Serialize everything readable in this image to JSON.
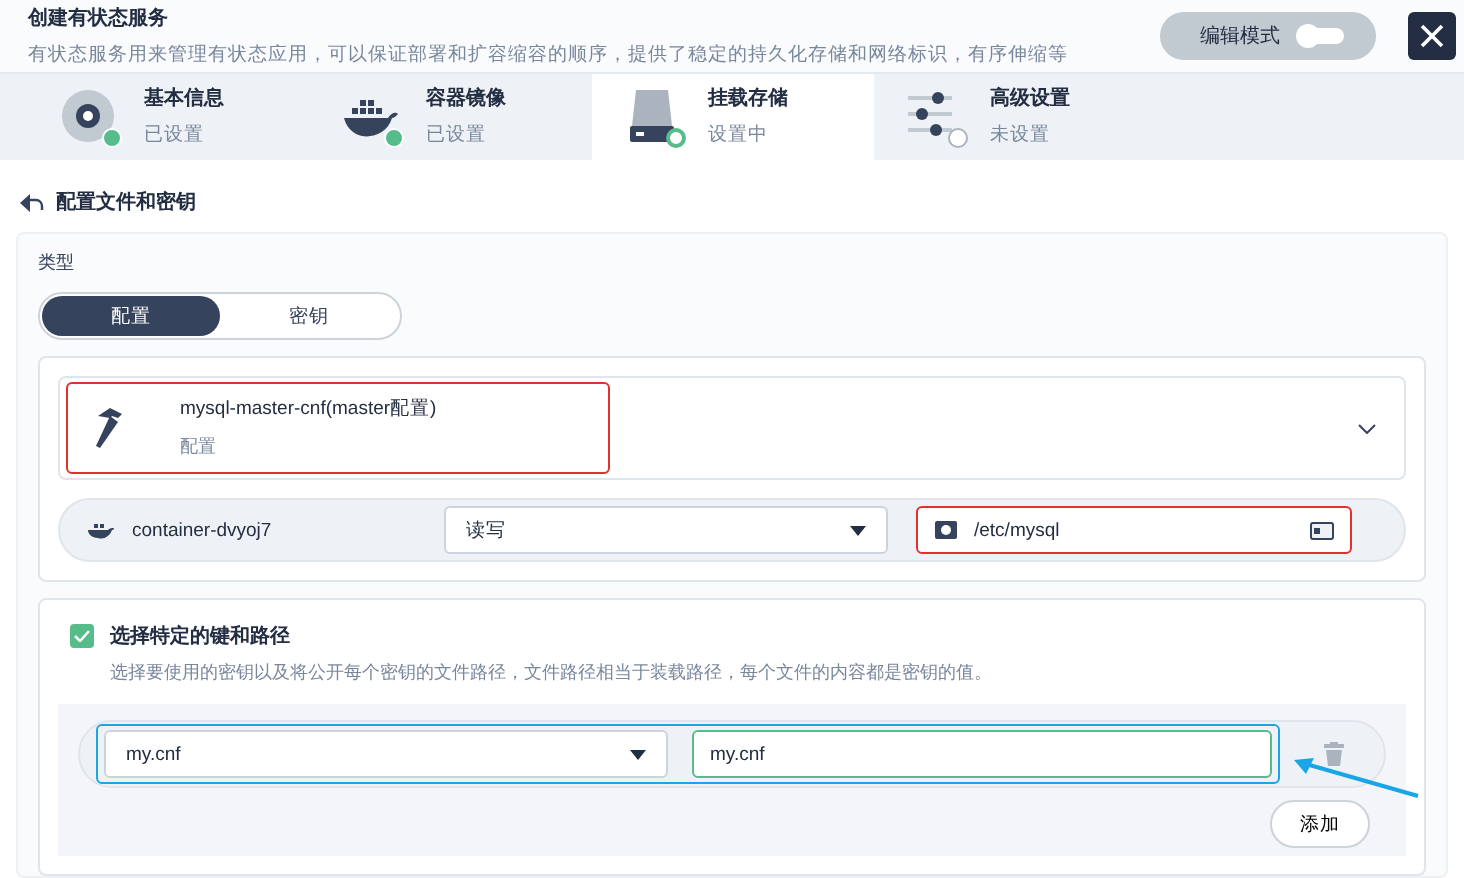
{
  "header": {
    "title": "创建有状态服务",
    "description": "有状态服务用来管理有状态应用，可以保证部署和扩容缩容的顺序，提供了稳定的持久化存储和网络标识，有序伸缩等",
    "edit_mode": {
      "label": "编辑模式",
      "on": false
    }
  },
  "steps": [
    {
      "label": "基本信息",
      "status": "已设置",
      "kind": "done",
      "selected": false
    },
    {
      "label": "容器镜像",
      "status": "已设置",
      "kind": "done",
      "selected": false
    },
    {
      "label": "挂载存储",
      "status": "设置中",
      "kind": "current",
      "selected": true
    },
    {
      "label": "高级设置",
      "status": "未设置",
      "kind": "todo",
      "selected": false
    }
  ],
  "section": {
    "title": "配置文件和密钥"
  },
  "type": {
    "label": "类型",
    "options": [
      {
        "label": "配置",
        "selected": true
      },
      {
        "label": "密钥",
        "selected": false
      }
    ]
  },
  "config": {
    "name": "mysql-master-cnf(master配置)",
    "kind_label": "配置",
    "highlighted": true
  },
  "mount": {
    "container": "container-dvyoj7",
    "access": "读写",
    "path": "/etc/mysql",
    "path_highlighted": true
  },
  "keys": {
    "checked": true,
    "title": "选择特定的键和路径",
    "description": "选择要使用的密钥以及将公开每个密钥的文件路径，文件路径相当于装载路径，每个文件的内容都是密钥的值。",
    "rows": [
      {
        "key": "my.cnf",
        "path": "my.cnf",
        "highlighted": true
      }
    ],
    "add_label": "添加"
  }
}
